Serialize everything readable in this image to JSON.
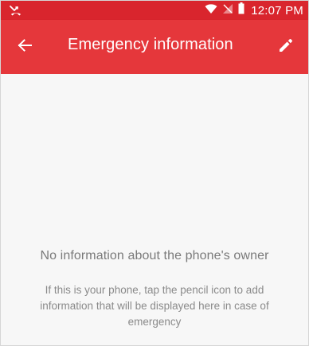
{
  "status_bar": {
    "time": "12:07 PM",
    "icons": [
      "missed-call-icon",
      "wifi-icon",
      "no-sim-icon",
      "battery-icon"
    ]
  },
  "app_bar": {
    "title": "Emergency information",
    "back_icon": "arrow-back-icon",
    "edit_icon": "pencil-icon"
  },
  "empty_state": {
    "title": "No information about the phone's owner",
    "description": "If this is your phone, tap the pencil icon to add information that will be displayed here in case of emergency"
  },
  "colors": {
    "status_bar": "#d9252d",
    "app_bar": "#e5373b",
    "background": "#f7f7f7",
    "text_secondary": "#7a7a7a"
  }
}
